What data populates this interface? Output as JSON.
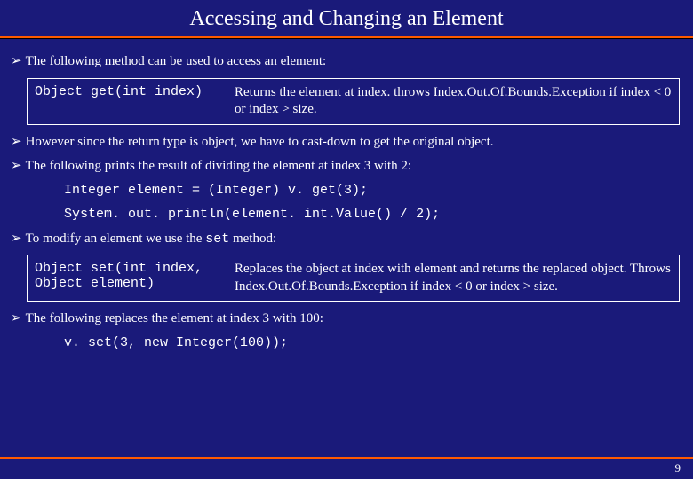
{
  "title": "Accessing and Changing an Element",
  "bullets": {
    "b1": "The following method can be used to access an element:",
    "b2": "However since the return type is object, we have to cast-down to get the original object.",
    "b3": "The following prints the result of dividing the element at index 3 with 2:",
    "b4_pre": "To modify an element we use the ",
    "b4_code": "set",
    "b4_post": "  method:",
    "b5": "The following replaces the element at index 3 with 100:"
  },
  "table1": {
    "code": "Object get(int index)",
    "desc": "Returns the element at index. throws Index.Out.Of.Bounds.Exception if index < 0 or index > size."
  },
  "code1": "Integer element = (Integer) v. get(3);",
  "code2": "System. out. println(element. int.Value() / 2);",
  "table2": {
    "code": "Object set(int index,\nObject element)",
    "desc": "Replaces the object at index with element and returns the replaced object. Throws Index.Out.Of.Bounds.Exception if  index < 0 or index > size."
  },
  "code3": "v. set(3, new Integer(100));",
  "page_number": "9"
}
